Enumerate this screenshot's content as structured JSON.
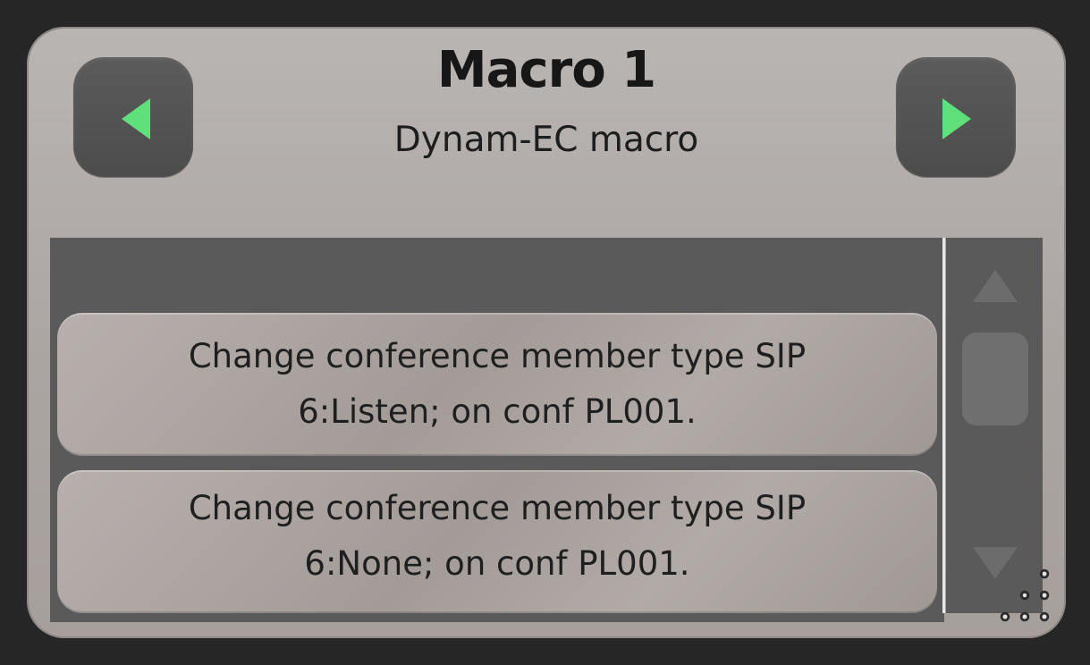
{
  "header": {
    "title": "Macro 1",
    "subtitle": "Dynam-EC macro"
  },
  "nav": {
    "prev_icon": "triangle-left-icon",
    "next_icon": "triangle-right-icon",
    "accent": "#5fe07a"
  },
  "list": {
    "items": [
      {
        "line1": "Change conference member type SIP",
        "line2": "6:Listen;  on conf PL001."
      },
      {
        "line1": "Change conference member type SIP",
        "line2": "6:None;  on conf PL001."
      }
    ]
  },
  "scrollbar": {
    "up_icon": "scroll-up-arrow-icon",
    "down_icon": "scroll-down-arrow-icon"
  },
  "resize": {
    "icon": "resize-grip-icon"
  }
}
